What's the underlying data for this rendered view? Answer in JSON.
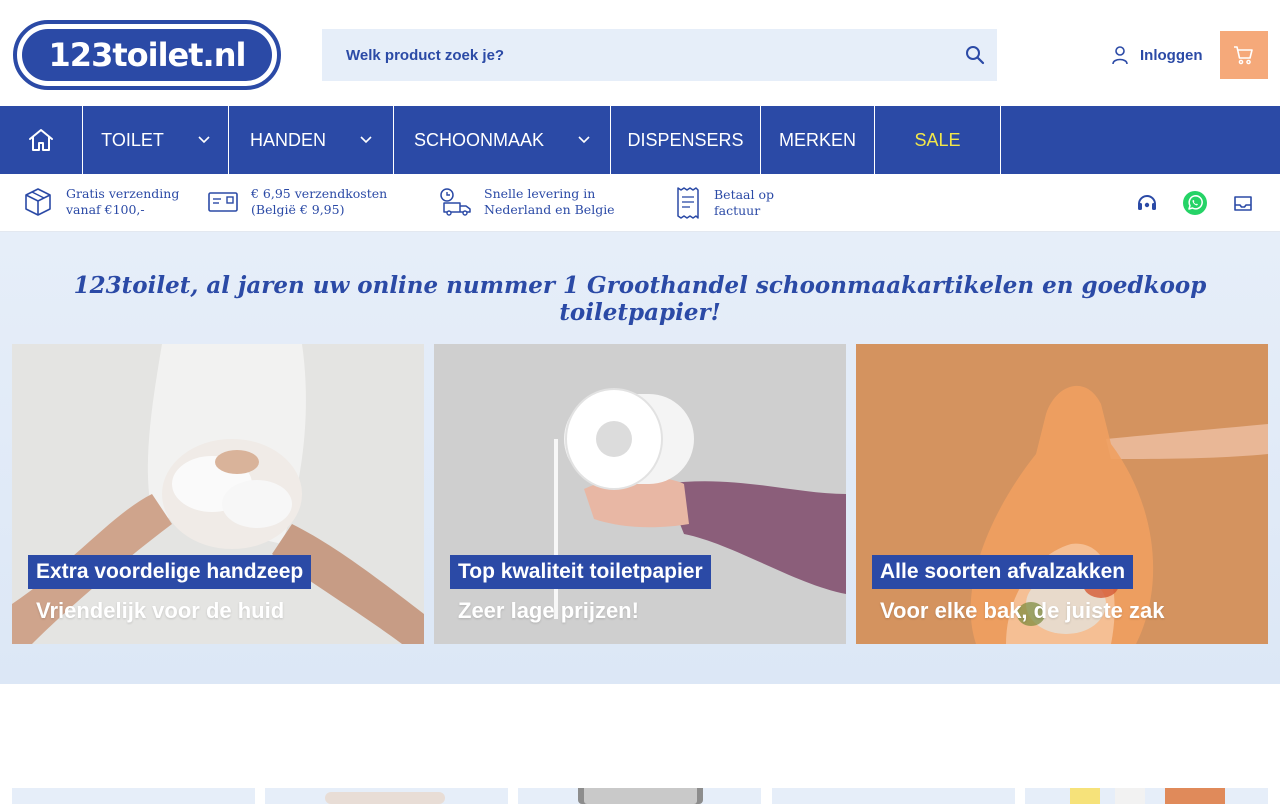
{
  "header": {
    "logo_text": "123toilet.nl",
    "search_placeholder": "Welk product zoek je?",
    "login_label": "Inloggen"
  },
  "nav": {
    "items": [
      {
        "label": "TOILET"
      },
      {
        "label": "HANDEN"
      },
      {
        "label": "SCHOONMAAK"
      },
      {
        "label": "DISPENSERS"
      },
      {
        "label": "MERKEN"
      },
      {
        "label": "SALE"
      }
    ]
  },
  "usp": [
    {
      "line1": "Gratis verzending",
      "line2": "vanaf €100,-",
      "icon": "box-icon"
    },
    {
      "line1": "€ 6,95 verzendkosten",
      "line2": "(België € 9,95)",
      "icon": "envelope-icon"
    },
    {
      "line1": "Snelle levering in",
      "line2": "Nederland en Belgie",
      "icon": "delivery-truck-icon"
    },
    {
      "line1": "Betaal op",
      "line2": "factuur",
      "icon": "receipt-icon"
    }
  ],
  "hero": {
    "title": "123toilet, al jaren uw online nummer 1 Groothandel schoonmaakartikelen en goedkoop toiletpapier!",
    "cards": [
      {
        "label": "Extra voordelige handzeep",
        "sub": "Vriendelijk voor de huid"
      },
      {
        "label": "Top kwaliteit toiletpapier",
        "sub": "Zeer lage prijzen!"
      },
      {
        "label": "Alle soorten afvalzakken",
        "sub": "Voor elke bak, de juiste zak"
      }
    ]
  },
  "colors": {
    "primary": "#2b4aa6",
    "light_bg": "#e6eef9",
    "cart": "#f5a97a",
    "sale": "#f2e74a",
    "whatsapp": "#25d366"
  }
}
